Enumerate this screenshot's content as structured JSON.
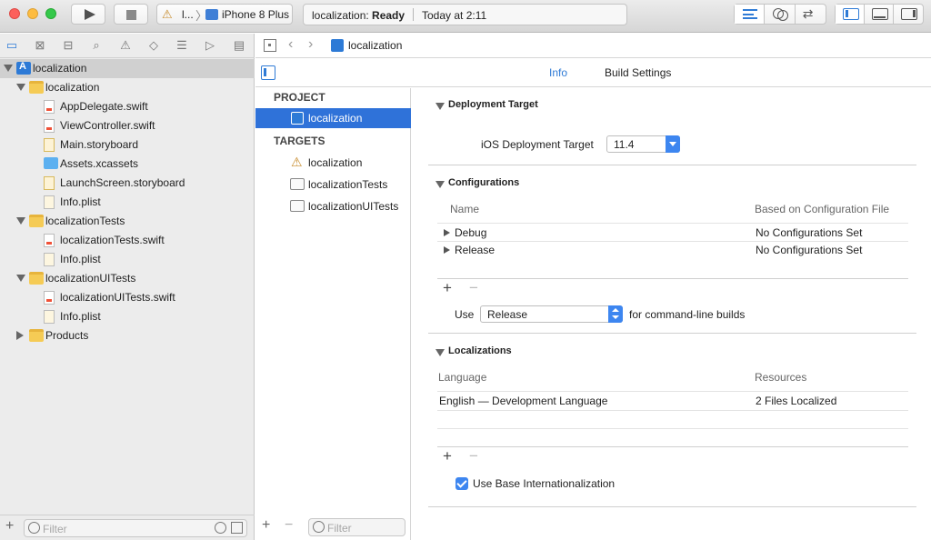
{
  "toolbar": {
    "scheme_name": "l...",
    "device": "iPhone 8 Plus",
    "status_project": "localization:",
    "status_state": "Ready",
    "status_time": "Today at 2:11"
  },
  "navigator": {
    "tabs": [
      "folder-icon",
      "source-control-icon",
      "hierarchy-icon",
      "search-icon",
      "warning-icon",
      "test-icon",
      "debug-icon",
      "breakpoint-icon",
      "report-icon"
    ],
    "tree": [
      {
        "label": "localization",
        "icon": "project-icon",
        "level": 0,
        "disclosure": "open",
        "selected": true
      },
      {
        "label": "localization",
        "icon": "folder-icon",
        "level": 1,
        "disclosure": "open"
      },
      {
        "label": "AppDelegate.swift",
        "icon": "swift-file-icon",
        "level": 2
      },
      {
        "label": "ViewController.swift",
        "icon": "swift-file-icon",
        "level": 2
      },
      {
        "label": "Main.storyboard",
        "icon": "storyboard-icon",
        "level": 2
      },
      {
        "label": "Assets.xcassets",
        "icon": "assets-icon",
        "level": 2
      },
      {
        "label": "LaunchScreen.storyboard",
        "icon": "storyboard-icon",
        "level": 2
      },
      {
        "label": "Info.plist",
        "icon": "plist-icon",
        "level": 2
      },
      {
        "label": "localizationTests",
        "icon": "folder-icon",
        "level": 1,
        "disclosure": "open"
      },
      {
        "label": "localizationTests.swift",
        "icon": "swift-file-icon",
        "level": 2
      },
      {
        "label": "Info.plist",
        "icon": "plist-icon",
        "level": 2
      },
      {
        "label": "localizationUITests",
        "icon": "folder-icon",
        "level": 1,
        "disclosure": "open"
      },
      {
        "label": "localizationUITests.swift",
        "icon": "swift-file-icon",
        "level": 2
      },
      {
        "label": "Info.plist",
        "icon": "plist-icon",
        "level": 2
      },
      {
        "label": "Products",
        "icon": "folder-icon",
        "level": 1,
        "disclosure": "closed"
      }
    ],
    "filter_placeholder": "Filter"
  },
  "jumpbar": {
    "file_name": "localization"
  },
  "editor_tabs": {
    "info": "Info",
    "build_settings": "Build Settings"
  },
  "project_list": {
    "project_header": "PROJECT",
    "project_item": "localization",
    "targets_header": "TARGETS",
    "targets": [
      "localization",
      "localizationTests",
      "localizationUITests"
    ],
    "filter_placeholder": "Filter"
  },
  "settings": {
    "deployment": {
      "title": "Deployment Target",
      "label": "iOS Deployment Target",
      "value": "11.4"
    },
    "configurations": {
      "title": "Configurations",
      "col_name": "Name",
      "col_file": "Based on Configuration File",
      "rows": [
        {
          "name": "Debug",
          "file": "No Configurations Set"
        },
        {
          "name": "Release",
          "file": "No Configurations Set"
        }
      ],
      "use_label": "Use",
      "use_value": "Release",
      "use_suffix": "for command-line builds"
    },
    "localizations": {
      "title": "Localizations",
      "col_language": "Language",
      "col_resources": "Resources",
      "rows": [
        {
          "language": "English — Development Language",
          "resources": "2 Files Localized"
        }
      ],
      "base_label": "Use Base Internationalization",
      "base_checked": true
    }
  },
  "colors": {
    "accent": "#2f72d9",
    "selection_gray": "#d0d0d0"
  }
}
